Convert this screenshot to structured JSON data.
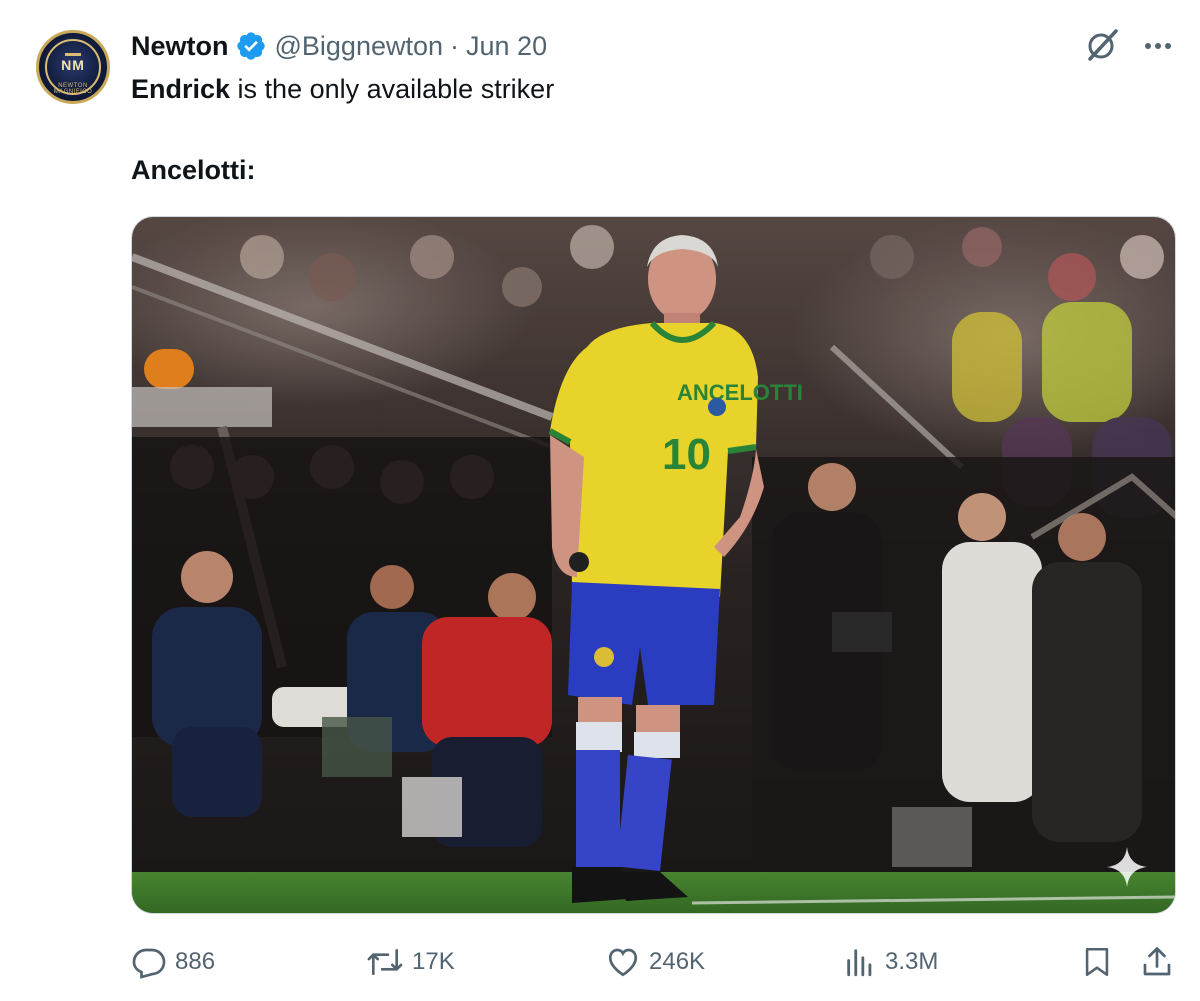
{
  "author": {
    "display_name": "Newton",
    "handle": "@Biggnewton",
    "separator": "·",
    "date": "Jun 20",
    "avatar_monogram": "NM",
    "avatar_ring_text": "NEWTON MAGNIFICO"
  },
  "tweet": {
    "line1_bold": "Endrick",
    "line1_rest": " is the only available striker",
    "line2": "Ancelotti:"
  },
  "media": {
    "jersey_name": "ANCELOTTI",
    "jersey_number": "10"
  },
  "actions": {
    "reply_count": "886",
    "retweet_count": "17K",
    "like_count": "246K",
    "view_count": "3.3M"
  },
  "icons": {
    "verified": "verified-badge-icon",
    "grok": "grok-icon",
    "more": "more-icon",
    "reply": "reply-icon",
    "retweet": "retweet-icon",
    "like": "heart-icon",
    "views": "views-icon",
    "bookmark": "bookmark-icon",
    "share": "share-icon"
  },
  "colors": {
    "verified_blue": "#1d9bf0",
    "muted": "#536471",
    "text": "#0f1419",
    "jersey_yellow": "#f2dc2c",
    "shorts_blue": "#2c3fc7",
    "pitch_green": "#3f7a2c"
  }
}
